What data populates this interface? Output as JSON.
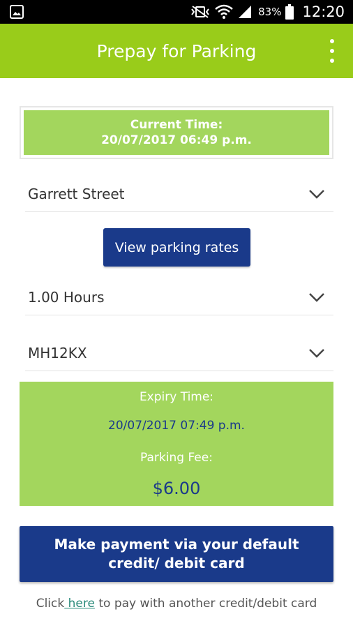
{
  "status_bar": {
    "battery": "83%",
    "time": "12:20",
    "icons": [
      "gallery-icon",
      "mute-vibrate-icon",
      "wifi-icon",
      "signal-icon",
      "battery-icon"
    ]
  },
  "header": {
    "title": "Prepay for Parking",
    "menu_icon": "overflow-menu-icon",
    "color": "#99cc1a"
  },
  "current_time": {
    "label": "Current Time:",
    "value": "20/07/2017 06:49 p.m."
  },
  "street": {
    "value": "Garrett Street"
  },
  "rates_button": {
    "label": "View parking rates"
  },
  "duration": {
    "value": "1.00 Hours"
  },
  "plate": {
    "value": "MH12KX"
  },
  "expiry": {
    "label": "Expiry Time:",
    "value": "20/07/2017 07:49 p.m.",
    "fee_label": "Parking Fee:",
    "fee_value": "$6.00"
  },
  "payment_button": {
    "label": "Make payment via your default credit/ debit card"
  },
  "alt_payment": {
    "prefix": "Click",
    "link": " here",
    "suffix": " to pay with another credit/debit card"
  },
  "colors": {
    "brand_green": "#99cc1a",
    "panel_green": "#a3d65d",
    "navy": "#1a3a8a",
    "link": "#2a8a7a"
  }
}
